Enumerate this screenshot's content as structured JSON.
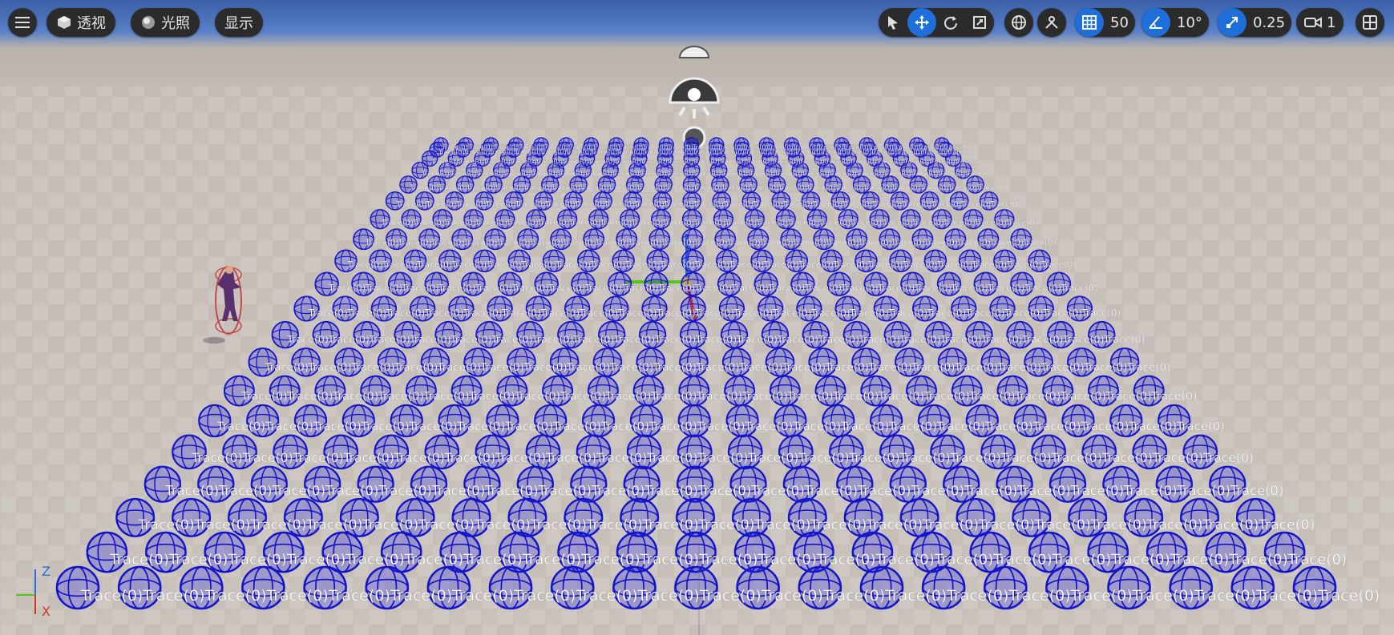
{
  "toolbar": {
    "menu_icon": "hamburger-menu-icon",
    "view_mode_label": "透视",
    "lighting_label": "光照",
    "show_label": "显示",
    "grid_snap_value": "50",
    "rotation_snap_value": "10°",
    "scale_snap_value": "0.25",
    "camera_speed_value": "1"
  },
  "axis": {
    "z": "Z",
    "x": "X"
  },
  "trace_label": "Trace(0)",
  "colors": {
    "accent": "#1e6fd9",
    "sphere": "#1414c8",
    "toolbar_bg": "#2b2b2b"
  }
}
